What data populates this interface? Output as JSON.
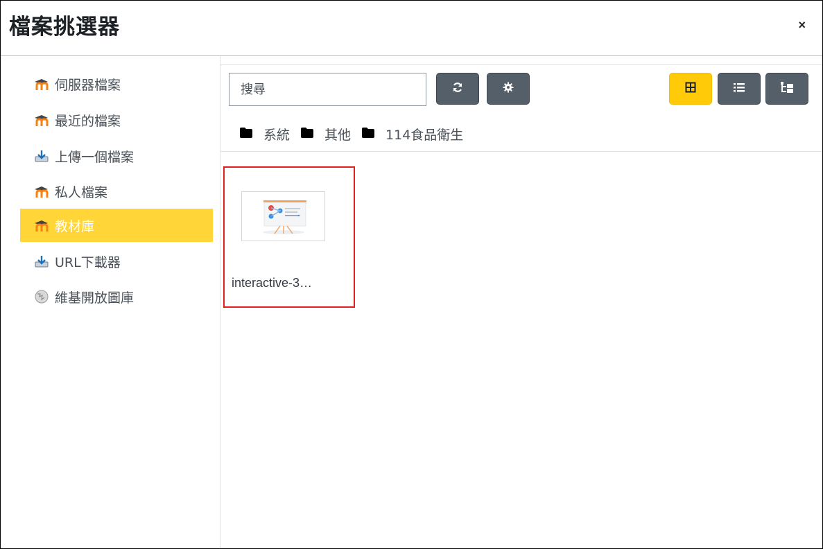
{
  "dialog": {
    "title": "檔案挑選器",
    "close_label": "×"
  },
  "sidebar": {
    "items": [
      {
        "label": "伺服器檔案",
        "icon": "moodle-icon",
        "active": false
      },
      {
        "label": "最近的檔案",
        "icon": "moodle-icon",
        "active": false
      },
      {
        "label": "上傳一個檔案",
        "icon": "upload-icon",
        "active": false
      },
      {
        "label": "私人檔案",
        "icon": "moodle-icon",
        "active": false
      },
      {
        "label": "教材庫",
        "icon": "moodle-icon",
        "active": true
      },
      {
        "label": "URL下載器",
        "icon": "url-download-icon",
        "active": false
      },
      {
        "label": "維基開放圖庫",
        "icon": "wikimedia-icon",
        "active": false
      }
    ]
  },
  "toolbar": {
    "search_placeholder": "搜尋",
    "refresh_icon": "refresh-icon",
    "settings_icon": "gear-icon",
    "views": [
      {
        "name": "icons-view",
        "active": true
      },
      {
        "name": "list-view",
        "active": false
      },
      {
        "name": "tree-view",
        "active": false
      }
    ]
  },
  "breadcrumb": [
    "系統",
    "其他",
    "114食品衛生"
  ],
  "files": [
    {
      "name": "interactive-3…",
      "thumbnail_icon": "presentation-icon"
    }
  ],
  "colors": {
    "accent_yellow": "#ffd538",
    "button_dark": "#555f6a",
    "selection_border": "#e02020"
  }
}
